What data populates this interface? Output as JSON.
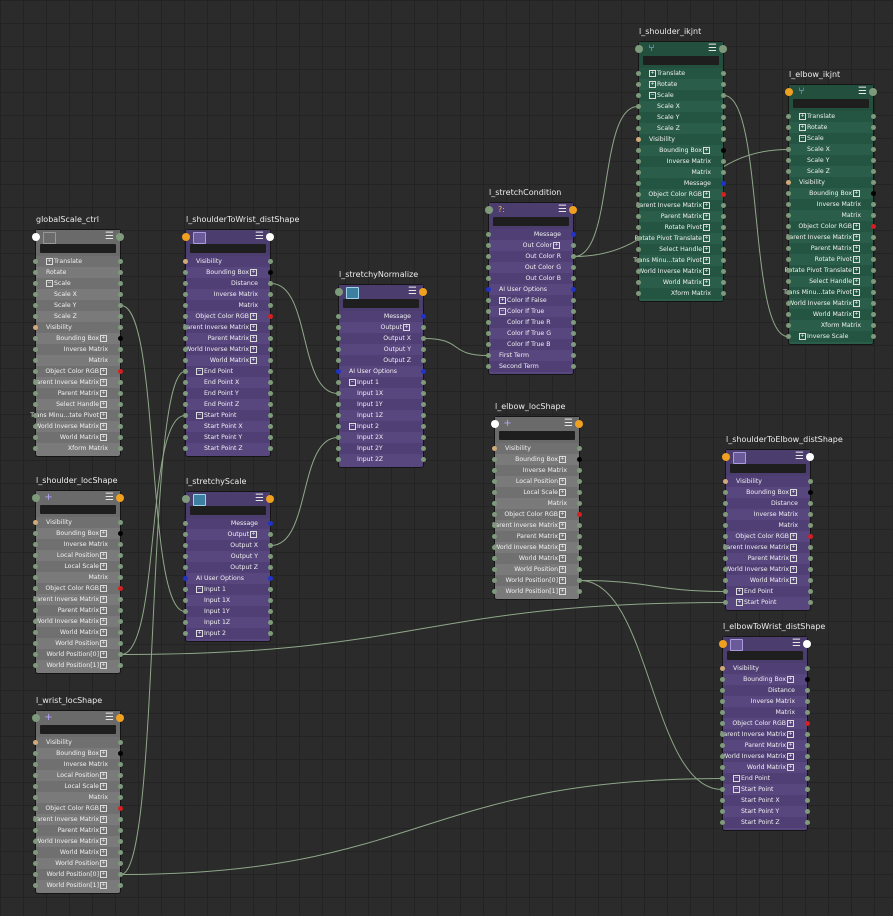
{
  "colors": {
    "wire": "#8fa889",
    "port": "#7e9a7b",
    "port_black": "#000000",
    "port_red": "#d42020",
    "port_blue": "#1f33c8",
    "port_orange": "#f0a020",
    "port_white": "#ffffff",
    "port_tan": "#d2aa7a"
  },
  "nodes": [
    {
      "id": "globalscale",
      "title": "globalScale_ctrl",
      "color": "gray",
      "icon": "transform-icon",
      "inL": "white",
      "outR": "port",
      "rows": [
        {
          "t": "Translate",
          "a": "l",
          "exp": "+"
        },
        {
          "t": "Rotate",
          "a": "l"
        },
        {
          "t": "Scale",
          "a": "l",
          "exp": "-"
        },
        {
          "t": "Scale X",
          "a": "l",
          "sub": 1
        },
        {
          "t": "Scale Y",
          "a": "l",
          "sub": 1
        },
        {
          "t": "Scale Z",
          "a": "l",
          "sub": 1
        },
        {
          "t": "Visibility",
          "a": "l",
          "pl": "tan"
        },
        {
          "t": "Bounding Box",
          "exp": "+",
          "pr": "black"
        },
        {
          "t": "Inverse Matrix"
        },
        {
          "t": "Matrix"
        },
        {
          "t": "Object Color RGB",
          "exp": "+",
          "pr": "red"
        },
        {
          "t": "Parent Inverse Matrix",
          "exp": "+"
        },
        {
          "t": "Parent Matrix",
          "exp": "+"
        },
        {
          "t": "Select Handle",
          "exp": "+"
        },
        {
          "t": "Trans Minu...tate Pivot",
          "exp": "+"
        },
        {
          "t": "World Inverse Matrix",
          "exp": "+"
        },
        {
          "t": "World Matrix",
          "exp": "+"
        },
        {
          "t": "Xform Matrix"
        }
      ]
    },
    {
      "id": "shoulderloc",
      "title": "l_shoulder_locShape",
      "color": "gray",
      "icon": "locator-icon",
      "inL": "port",
      "outR": "orange",
      "rows": [
        {
          "t": "Visibility",
          "a": "l",
          "pl": "tan"
        },
        {
          "t": "Bounding Box",
          "exp": "+",
          "pr": "black"
        },
        {
          "t": "Inverse Matrix"
        },
        {
          "t": "Local Position",
          "exp": "+"
        },
        {
          "t": "Local Scale",
          "exp": "+"
        },
        {
          "t": "Matrix"
        },
        {
          "t": "Object Color RGB",
          "exp": "+",
          "pr": "red"
        },
        {
          "t": "Parent Inverse Matrix",
          "exp": "+"
        },
        {
          "t": "Parent Matrix",
          "exp": "+"
        },
        {
          "t": "World Inverse Matrix",
          "exp": "+"
        },
        {
          "t": "World Matrix",
          "exp": "+"
        },
        {
          "t": "World Position",
          "exp": "+"
        },
        {
          "t": "World Position[0]",
          "exp": "+"
        },
        {
          "t": "World Position[1]",
          "exp": "+"
        }
      ]
    },
    {
      "id": "wristloc",
      "title": "l_wrist_locShape",
      "color": "gray",
      "icon": "locator-icon",
      "inL": "port",
      "outR": "orange",
      "rows": [
        {
          "t": "Visibility",
          "a": "l",
          "pl": "tan"
        },
        {
          "t": "Bounding Box",
          "exp": "+",
          "pr": "black"
        },
        {
          "t": "Inverse Matrix"
        },
        {
          "t": "Local Position",
          "exp": "+"
        },
        {
          "t": "Local Scale",
          "exp": "+"
        },
        {
          "t": "Matrix"
        },
        {
          "t": "Object Color RGB",
          "exp": "+",
          "pr": "red"
        },
        {
          "t": "Parent Inverse Matrix",
          "exp": "+"
        },
        {
          "t": "Parent Matrix",
          "exp": "+"
        },
        {
          "t": "World Inverse Matrix",
          "exp": "+"
        },
        {
          "t": "World Matrix",
          "exp": "+"
        },
        {
          "t": "World Position",
          "exp": "+"
        },
        {
          "t": "World Position[0]",
          "exp": "+"
        },
        {
          "t": "World Position[1]",
          "exp": "+"
        }
      ]
    },
    {
      "id": "s2wdist",
      "title": "l_shoulderToWrist_distShape",
      "color": "purple",
      "icon": "distance-icon",
      "inL": "orange",
      "outR": "white",
      "rows": [
        {
          "t": "Visibility",
          "a": "l",
          "pl": "tan"
        },
        {
          "t": "Bounding Box",
          "exp": "+",
          "pr": "black"
        },
        {
          "t": "Distance"
        },
        {
          "t": "Inverse Matrix"
        },
        {
          "t": "Matrix"
        },
        {
          "t": "Object Color RGB",
          "exp": "+",
          "pr": "red"
        },
        {
          "t": "Parent Inverse Matrix",
          "exp": "+"
        },
        {
          "t": "Parent Matrix",
          "exp": "+"
        },
        {
          "t": "World Inverse Matrix",
          "exp": "+"
        },
        {
          "t": "World Matrix",
          "exp": "+"
        },
        {
          "t": "End Point",
          "a": "l",
          "exp": "-"
        },
        {
          "t": "End Point X",
          "a": "l",
          "sub": 1
        },
        {
          "t": "End Point Y",
          "a": "l",
          "sub": 1
        },
        {
          "t": "End Point Z",
          "a": "l",
          "sub": 1
        },
        {
          "t": "Start Point",
          "a": "l",
          "exp": "-"
        },
        {
          "t": "Start Point X",
          "a": "l",
          "sub": 1
        },
        {
          "t": "Start Point Y",
          "a": "l",
          "sub": 1
        },
        {
          "t": "Start Point Z",
          "a": "l",
          "sub": 1
        }
      ]
    },
    {
      "id": "stretchyscale",
      "title": "l_stretchyScale",
      "color": "purple",
      "icon": "multiply-divide-icon",
      "inL": "port",
      "outR": "orange",
      "rows": [
        {
          "t": "Message",
          "pr": "blue"
        },
        {
          "t": "Output",
          "exp": "+"
        },
        {
          "t": "Output X"
        },
        {
          "t": "Output Y"
        },
        {
          "t": "Output Z"
        },
        {
          "t": "AI User Options",
          "a": "l",
          "pl": "blue",
          "pr": "blue"
        },
        {
          "t": "Input 1",
          "a": "l",
          "exp": "-"
        },
        {
          "t": "Input 1X",
          "a": "l",
          "sub": 1
        },
        {
          "t": "Input 1Y",
          "a": "l",
          "sub": 1
        },
        {
          "t": "Input 1Z",
          "a": "l",
          "sub": 1
        },
        {
          "t": "Input 2",
          "a": "l",
          "exp": "+"
        }
      ]
    },
    {
      "id": "stretchynorm",
      "title": "l_stretchyNormalize",
      "color": "purple",
      "icon": "multiply-divide-icon",
      "inL": "port",
      "outR": "orange",
      "rows": [
        {
          "t": "Message",
          "pr": "blue"
        },
        {
          "t": "Output",
          "exp": "+"
        },
        {
          "t": "Output X"
        },
        {
          "t": "Output Y"
        },
        {
          "t": "Output Z"
        },
        {
          "t": "AI User Options",
          "a": "l",
          "pl": "blue",
          "pr": "blue"
        },
        {
          "t": "Input 1",
          "a": "l",
          "exp": "-"
        },
        {
          "t": "Input 1X",
          "a": "l",
          "sub": 1
        },
        {
          "t": "Input 1Y",
          "a": "l",
          "sub": 1
        },
        {
          "t": "Input 1Z",
          "a": "l",
          "sub": 1
        },
        {
          "t": "Input 2",
          "a": "l",
          "exp": "-"
        },
        {
          "t": "Input 2X",
          "a": "l",
          "sub": 1
        },
        {
          "t": "Input 2Y",
          "a": "l",
          "sub": 1
        },
        {
          "t": "Input 2Z",
          "a": "l",
          "sub": 1
        }
      ]
    },
    {
      "id": "stretchcond",
      "title": "l_stretchCondition",
      "color": "purple",
      "icon": "condition-icon",
      "inL": "port",
      "outR": "orange",
      "rows": [
        {
          "t": "Message",
          "pr": "blue"
        },
        {
          "t": "Out Color",
          "exp": "+"
        },
        {
          "t": "Out Color R"
        },
        {
          "t": "Out Color G"
        },
        {
          "t": "Out Color B"
        },
        {
          "t": "AI User Options",
          "a": "l",
          "pl": "blue",
          "pr": "blue"
        },
        {
          "t": "Color If False",
          "a": "l",
          "exp": "+"
        },
        {
          "t": "Color If True",
          "a": "l",
          "exp": "-"
        },
        {
          "t": "Color If True R",
          "a": "l",
          "sub": 1
        },
        {
          "t": "Color If True G",
          "a": "l",
          "sub": 1
        },
        {
          "t": "Color If True B",
          "a": "l",
          "sub": 1
        },
        {
          "t": "First Term",
          "a": "l"
        },
        {
          "t": "Second Term",
          "a": "l"
        }
      ]
    },
    {
      "id": "elbowloc",
      "title": "l_elbow_locShape",
      "color": "gray",
      "icon": "locator-icon",
      "inL": "white",
      "outR": "orange",
      "rows": [
        {
          "t": "Visibility",
          "a": "l",
          "pl": "tan"
        },
        {
          "t": "Bounding Box",
          "exp": "+",
          "pr": "black"
        },
        {
          "t": "Inverse Matrix"
        },
        {
          "t": "Local Position",
          "exp": "+"
        },
        {
          "t": "Local Scale",
          "exp": "+"
        },
        {
          "t": "Matrix"
        },
        {
          "t": "Object Color RGB",
          "exp": "+",
          "pr": "red"
        },
        {
          "t": "Parent Inverse Matrix",
          "exp": "+"
        },
        {
          "t": "Parent Matrix",
          "exp": "+"
        },
        {
          "t": "World Inverse Matrix",
          "exp": "+"
        },
        {
          "t": "World Matrix",
          "exp": "+"
        },
        {
          "t": "World Position",
          "exp": "+"
        },
        {
          "t": "World Position[0]",
          "exp": "+"
        },
        {
          "t": "World Position[1]",
          "exp": "+"
        }
      ]
    },
    {
      "id": "shoulderik",
      "title": "l_shoulder_ikjnt",
      "color": "green",
      "icon": "joint-icon",
      "inL": "port",
      "outR": "port",
      "rows": [
        {
          "t": "Translate",
          "a": "l",
          "exp": "+"
        },
        {
          "t": "Rotate",
          "a": "l",
          "exp": "+"
        },
        {
          "t": "Scale",
          "a": "l",
          "exp": "-"
        },
        {
          "t": "Scale X",
          "a": "l",
          "sub": 1
        },
        {
          "t": "Scale Y",
          "a": "l",
          "sub": 1
        },
        {
          "t": "Scale Z",
          "a": "l",
          "sub": 1
        },
        {
          "t": "Visibility",
          "a": "l",
          "pl": "tan"
        },
        {
          "t": "Bounding Box",
          "exp": "+",
          "pr": "black"
        },
        {
          "t": "Inverse Matrix"
        },
        {
          "t": "Matrix"
        },
        {
          "t": "Message",
          "pr": "blue"
        },
        {
          "t": "Object Color RGB",
          "exp": "+",
          "pr": "red"
        },
        {
          "t": "Parent Inverse Matrix",
          "exp": "+"
        },
        {
          "t": "Parent Matrix",
          "exp": "+"
        },
        {
          "t": "Rotate Pivot",
          "exp": "+"
        },
        {
          "t": "Rotate Pivot Translate",
          "exp": "+"
        },
        {
          "t": "Select Handle",
          "exp": "+"
        },
        {
          "t": "Trans Minu...tate Pivot",
          "exp": "+"
        },
        {
          "t": "World Inverse Matrix",
          "exp": "+"
        },
        {
          "t": "World Matrix",
          "exp": "+"
        },
        {
          "t": "Xform Matrix"
        }
      ]
    },
    {
      "id": "elbowik",
      "title": "l_elbow_ikjnt",
      "color": "green",
      "icon": "joint-icon",
      "inL": "orange",
      "outR": "port",
      "rows": [
        {
          "t": "Translate",
          "a": "l",
          "exp": "+"
        },
        {
          "t": "Rotate",
          "a": "l",
          "exp": "+"
        },
        {
          "t": "Scale",
          "a": "l",
          "exp": "-"
        },
        {
          "t": "Scale X",
          "a": "l",
          "sub": 1
        },
        {
          "t": "Scale Y",
          "a": "l",
          "sub": 1
        },
        {
          "t": "Scale Z",
          "a": "l",
          "sub": 1
        },
        {
          "t": "Visibility",
          "a": "l",
          "pl": "tan"
        },
        {
          "t": "Bounding Box",
          "exp": "+",
          "pr": "black"
        },
        {
          "t": "Inverse Matrix"
        },
        {
          "t": "Matrix"
        },
        {
          "t": "Object Color RGB",
          "exp": "+",
          "pr": "red"
        },
        {
          "t": "Parent Inverse Matrix",
          "exp": "+"
        },
        {
          "t": "Parent Matrix",
          "exp": "+"
        },
        {
          "t": "Rotate Pivot",
          "exp": "+"
        },
        {
          "t": "Rotate Pivot Translate",
          "exp": "+"
        },
        {
          "t": "Select Handle",
          "exp": "+"
        },
        {
          "t": "Trans Minu...tate Pivot",
          "exp": "+"
        },
        {
          "t": "World Inverse Matrix",
          "exp": "+"
        },
        {
          "t": "World Matrix",
          "exp": "+"
        },
        {
          "t": "Xform Matrix"
        },
        {
          "t": "Inverse Scale",
          "a": "l",
          "exp": "+"
        }
      ]
    },
    {
      "id": "s2edist",
      "title": "l_shoulderToElbow_distShape",
      "color": "purple",
      "icon": "distance-icon",
      "inL": "orange",
      "outR": "white",
      "rows": [
        {
          "t": "Visibility",
          "a": "l",
          "pl": "tan"
        },
        {
          "t": "Bounding Box",
          "exp": "+",
          "pr": "black"
        },
        {
          "t": "Distance"
        },
        {
          "t": "Inverse Matrix"
        },
        {
          "t": "Matrix"
        },
        {
          "t": "Object Color RGB",
          "exp": "+",
          "pr": "red"
        },
        {
          "t": "Parent Inverse Matrix",
          "exp": "+"
        },
        {
          "t": "Parent Matrix",
          "exp": "+"
        },
        {
          "t": "World Inverse Matrix",
          "exp": "+"
        },
        {
          "t": "World Matrix",
          "exp": "+"
        },
        {
          "t": "End Point",
          "a": "l",
          "exp": "+"
        },
        {
          "t": "Start Point",
          "a": "l",
          "exp": "+"
        }
      ]
    },
    {
      "id": "e2wdist",
      "title": "l_elbowToWrist_distShape",
      "color": "purple",
      "icon": "distance-icon",
      "inL": "orange",
      "outR": "white",
      "rows": [
        {
          "t": "Visibility",
          "a": "l",
          "pl": "tan"
        },
        {
          "t": "Bounding Box",
          "exp": "+",
          "pr": "black"
        },
        {
          "t": "Distance"
        },
        {
          "t": "Inverse Matrix"
        },
        {
          "t": "Matrix"
        },
        {
          "t": "Object Color RGB",
          "exp": "+",
          "pr": "red"
        },
        {
          "t": "Parent Inverse Matrix",
          "exp": "+"
        },
        {
          "t": "Parent Matrix",
          "exp": "+"
        },
        {
          "t": "World Inverse Matrix",
          "exp": "+"
        },
        {
          "t": "World Matrix",
          "exp": "+"
        },
        {
          "t": "End Point",
          "a": "l",
          "exp": "-"
        },
        {
          "t": "Start Point",
          "a": "l",
          "exp": "-"
        },
        {
          "t": "Start Point X",
          "a": "l",
          "sub": 1
        },
        {
          "t": "Start Point Y",
          "a": "l",
          "sub": 1
        },
        {
          "t": "Start Point Z",
          "a": "l",
          "sub": 1
        }
      ]
    }
  ],
  "connections": [
    {
      "from": "globalscale",
      "fromRow": 4,
      "to": "stretchyscale",
      "toRow": 8
    },
    {
      "from": "shoulderloc",
      "fromRow": 12,
      "to": "s2wdist",
      "toRow": 14
    },
    {
      "from": "shoulderloc",
      "fromRow": 12,
      "to": "s2edist",
      "toRow": 11
    },
    {
      "from": "wristloc",
      "fromRow": 12,
      "to": "s2wdist",
      "toRow": 10
    },
    {
      "from": "wristloc",
      "fromRow": 12,
      "to": "e2wdist",
      "toRow": 10
    },
    {
      "from": "s2wdist",
      "fromRow": 2,
      "to": "stretchynorm",
      "toRow": 7
    },
    {
      "from": "stretchyscale",
      "fromRow": 2,
      "to": "stretchynorm",
      "toRow": 11
    },
    {
      "from": "stretchynorm",
      "fromRow": 2,
      "to": "stretchcond",
      "toRow": 11
    },
    {
      "from": "stretchcond",
      "fromRow": 2,
      "to": "shoulderik",
      "toRow": 3
    },
    {
      "from": "stretchcond",
      "fromRow": 2,
      "to": "elbowik",
      "toRow": 3
    },
    {
      "from": "shoulderik",
      "fromRow": 2,
      "to": "elbowik",
      "toRow": 20
    },
    {
      "from": "elbowloc",
      "fromRow": 12,
      "to": "s2edist",
      "toRow": 10
    },
    {
      "from": "elbowloc",
      "fromRow": 12,
      "to": "e2wdist",
      "toRow": 11
    }
  ]
}
